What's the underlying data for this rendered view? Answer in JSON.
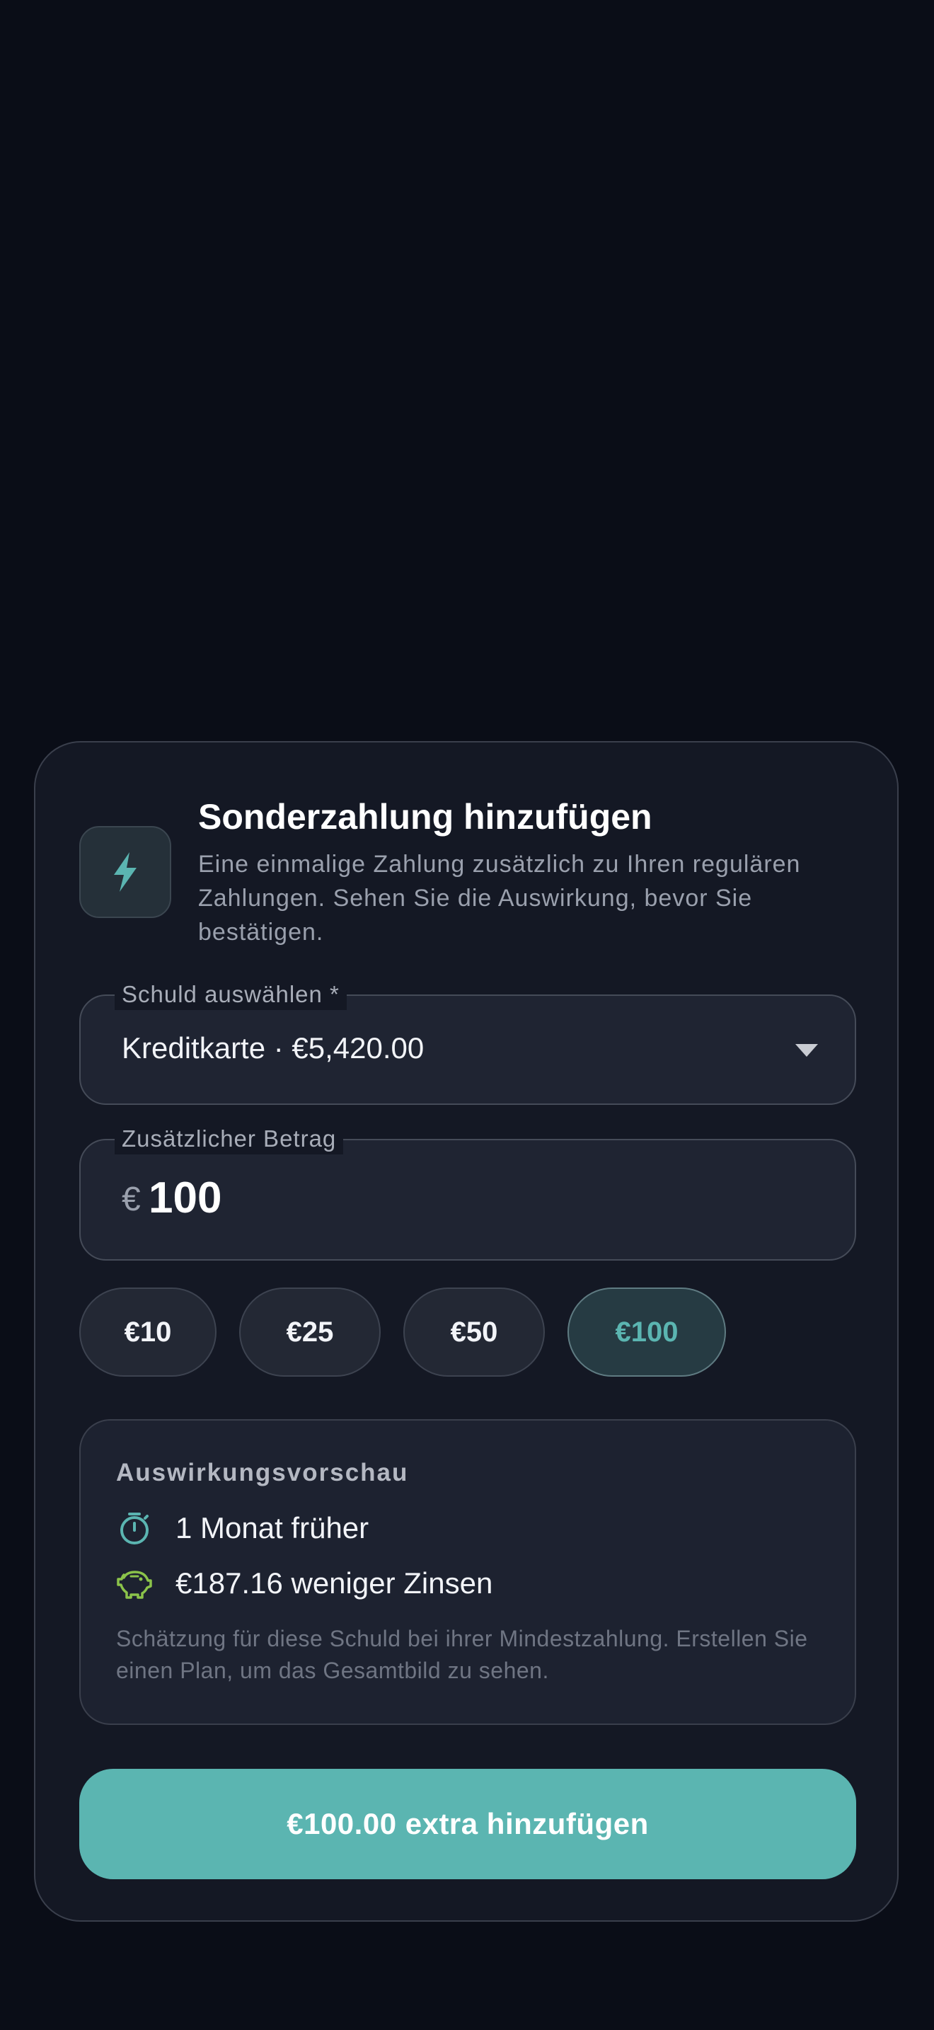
{
  "dialog": {
    "title": "Sonderzahlung hinzufügen",
    "description": "Eine einmalige Zahlung zusätzlich zu Ihren regulären Zahlungen. Sehen Sie die Auswirkung, bevor Sie bestätigen.",
    "icon": "lightning-bolt-icon"
  },
  "debt_select": {
    "label": "Schuld auswählen *",
    "value": "Kreditkarte · €5,420.00",
    "icon": "chevron-down-icon"
  },
  "amount": {
    "label": "Zusätzlicher Betrag",
    "currency": "€",
    "value": "100"
  },
  "quick_amounts": [
    {
      "label": "€10",
      "selected": false
    },
    {
      "label": "€25",
      "selected": false
    },
    {
      "label": "€50",
      "selected": false
    },
    {
      "label": "€100",
      "selected": true
    }
  ],
  "impact": {
    "title": "Auswirkungsvorschau",
    "items": [
      {
        "icon": "timer-icon",
        "text": "1 Monat früher"
      },
      {
        "icon": "piggy-bank-icon",
        "text": "€187.16 weniger Zinsen"
      }
    ],
    "note": "Schätzung für diese Schuld bei ihrer Mindestzahlung. Erstellen Sie einen Plan, um das Gesamtbild zu sehen."
  },
  "submit": {
    "label": "€100.00 extra hinzufügen"
  },
  "colors": {
    "background": "#0a0d17",
    "sheet": "#141824",
    "accent": "#5bb5b1",
    "piggy": "#8bc34a"
  }
}
